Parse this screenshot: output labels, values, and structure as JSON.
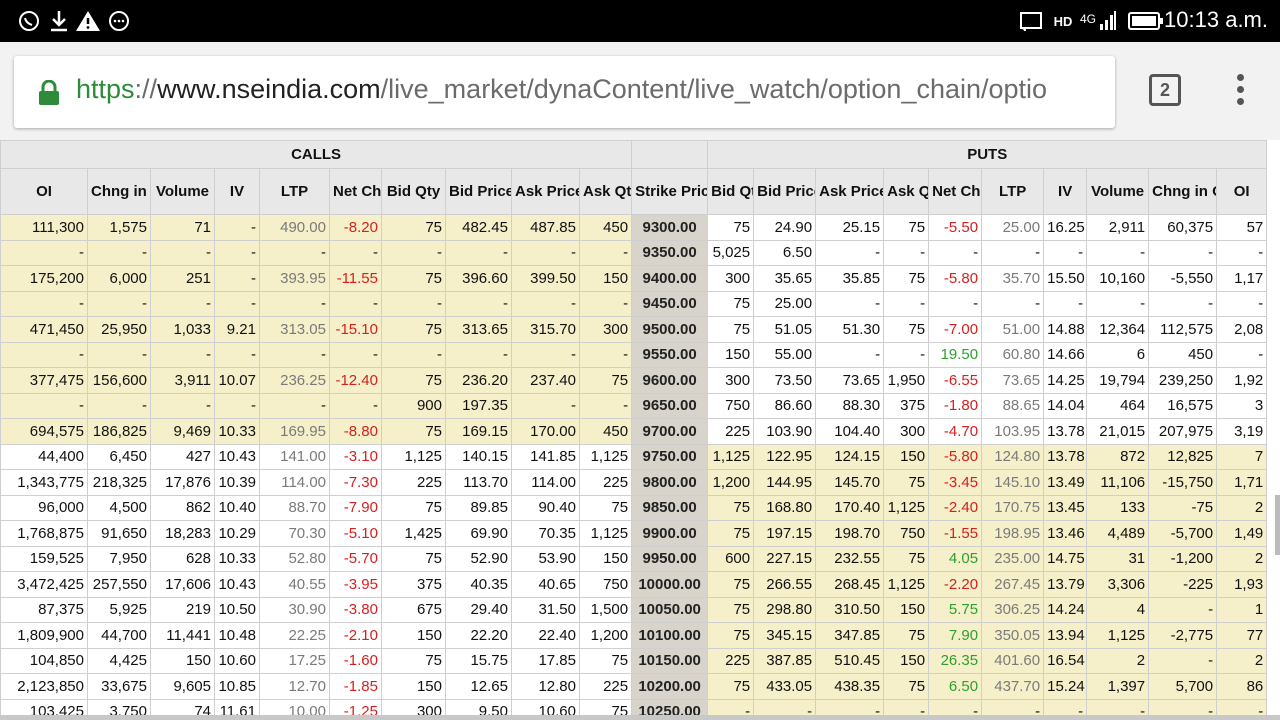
{
  "status_bar": {
    "time": "10:13 a.m.",
    "network": "4G",
    "hd": "HD",
    "icons": [
      "whatsapp-icon",
      "download-icon",
      "warning-icon",
      "more-circle-icon",
      "cast-icon",
      "signal-icon",
      "battery-icon"
    ]
  },
  "browser": {
    "url_protocol": "https",
    "url_sep": "://",
    "url_domain": "www.nseindia.com",
    "url_path": "/live_market/dynaContent/live_watch/option_chain/optio",
    "tab_count": "2"
  },
  "table": {
    "calls_label": "CALLS",
    "puts_label": "PUTS",
    "call_headers": [
      "OI",
      "Chng in OI",
      "Volume",
      "IV",
      "LTP",
      "Net Chng",
      "Bid Qty",
      "Bid Price",
      "Ask Price",
      "Ask Qty"
    ],
    "strike_header": "Strike Price",
    "put_headers": [
      "Bid Qty",
      "Bid Price",
      "Ask Price",
      "Ask Qty",
      "Net Chng",
      "LTP",
      "IV",
      "Volume",
      "Chng in OI",
      "OI"
    ],
    "rows": [
      {
        "calls": [
          "111,300",
          "1,575",
          "71",
          "-",
          "490.00",
          "-8.20",
          "75",
          "482.45",
          "487.85",
          "450"
        ],
        "strike": "9300.00",
        "puts": [
          "75",
          "24.90",
          "25.15",
          "75",
          "-5.50",
          "25.00",
          "16.25",
          "2,911",
          "60,375",
          "57"
        ],
        "call_itm": true,
        "put_itm": false
      },
      {
        "calls": [
          "-",
          "-",
          "-",
          "-",
          "-",
          "-",
          "-",
          "-",
          "-",
          "-"
        ],
        "strike": "9350.00",
        "puts": [
          "5,025",
          "6.50",
          "-",
          "-",
          "-",
          "-",
          "-",
          "-",
          "-",
          "-"
        ],
        "call_itm": true,
        "put_itm": false
      },
      {
        "calls": [
          "175,200",
          "6,000",
          "251",
          "-",
          "393.95",
          "-11.55",
          "75",
          "396.60",
          "399.50",
          "150"
        ],
        "strike": "9400.00",
        "puts": [
          "300",
          "35.65",
          "35.85",
          "75",
          "-5.80",
          "35.70",
          "15.50",
          "10,160",
          "-5,550",
          "1,17"
        ],
        "call_itm": true,
        "put_itm": false
      },
      {
        "calls": [
          "-",
          "-",
          "-",
          "-",
          "-",
          "-",
          "-",
          "-",
          "-",
          "-"
        ],
        "strike": "9450.00",
        "puts": [
          "75",
          "25.00",
          "-",
          "-",
          "-",
          "-",
          "-",
          "-",
          "-",
          "-"
        ],
        "call_itm": true,
        "put_itm": false
      },
      {
        "calls": [
          "471,450",
          "25,950",
          "1,033",
          "9.21",
          "313.05",
          "-15.10",
          "75",
          "313.65",
          "315.70",
          "300"
        ],
        "strike": "9500.00",
        "puts": [
          "75",
          "51.05",
          "51.30",
          "75",
          "-7.00",
          "51.00",
          "14.88",
          "12,364",
          "112,575",
          "2,08"
        ],
        "call_itm": true,
        "put_itm": false
      },
      {
        "calls": [
          "-",
          "-",
          "-",
          "-",
          "-",
          "-",
          "-",
          "-",
          "-",
          "-"
        ],
        "strike": "9550.00",
        "puts": [
          "150",
          "55.00",
          "-",
          "-",
          "19.50",
          "60.80",
          "14.66",
          "6",
          "450",
          "-"
        ],
        "call_itm": true,
        "put_itm": false
      },
      {
        "calls": [
          "377,475",
          "156,600",
          "3,911",
          "10.07",
          "236.25",
          "-12.40",
          "75",
          "236.20",
          "237.40",
          "75"
        ],
        "strike": "9600.00",
        "puts": [
          "300",
          "73.50",
          "73.65",
          "1,950",
          "-6.55",
          "73.65",
          "14.25",
          "19,794",
          "239,250",
          "1,92"
        ],
        "call_itm": true,
        "put_itm": false
      },
      {
        "calls": [
          "-",
          "-",
          "-",
          "-",
          "-",
          "-",
          "900",
          "197.35",
          "-",
          "-"
        ],
        "strike": "9650.00",
        "puts": [
          "750",
          "86.60",
          "88.30",
          "375",
          "-1.80",
          "88.65",
          "14.04",
          "464",
          "16,575",
          "3"
        ],
        "call_itm": true,
        "put_itm": false
      },
      {
        "calls": [
          "694,575",
          "186,825",
          "9,469",
          "10.33",
          "169.95",
          "-8.80",
          "75",
          "169.15",
          "170.00",
          "450"
        ],
        "strike": "9700.00",
        "puts": [
          "225",
          "103.90",
          "104.40",
          "300",
          "-4.70",
          "103.95",
          "13.78",
          "21,015",
          "207,975",
          "3,19"
        ],
        "call_itm": true,
        "put_itm": false
      },
      {
        "calls": [
          "44,400",
          "6,450",
          "427",
          "10.43",
          "141.00",
          "-3.10",
          "1,125",
          "140.15",
          "141.85",
          "1,125"
        ],
        "strike": "9750.00",
        "puts": [
          "1,125",
          "122.95",
          "124.15",
          "150",
          "-5.80",
          "124.80",
          "13.78",
          "872",
          "12,825",
          "7"
        ],
        "call_itm": false,
        "put_itm": true
      },
      {
        "calls": [
          "1,343,775",
          "218,325",
          "17,876",
          "10.39",
          "114.00",
          "-7.30",
          "225",
          "113.70",
          "114.00",
          "225"
        ],
        "strike": "9800.00",
        "puts": [
          "1,200",
          "144.95",
          "145.70",
          "75",
          "-3.45",
          "145.10",
          "13.49",
          "11,106",
          "-15,750",
          "1,71"
        ],
        "call_itm": false,
        "put_itm": true
      },
      {
        "calls": [
          "96,000",
          "4,500",
          "862",
          "10.40",
          "88.70",
          "-7.90",
          "75",
          "89.85",
          "90.40",
          "75"
        ],
        "strike": "9850.00",
        "puts": [
          "75",
          "168.80",
          "170.40",
          "1,125",
          "-2.40",
          "170.75",
          "13.45",
          "133",
          "-75",
          "2"
        ],
        "call_itm": false,
        "put_itm": true
      },
      {
        "calls": [
          "1,768,875",
          "91,650",
          "18,283",
          "10.29",
          "70.30",
          "-5.10",
          "1,425",
          "69.90",
          "70.35",
          "1,125"
        ],
        "strike": "9900.00",
        "puts": [
          "75",
          "197.15",
          "198.70",
          "750",
          "-1.55",
          "198.95",
          "13.46",
          "4,489",
          "-5,700",
          "1,49"
        ],
        "call_itm": false,
        "put_itm": true
      },
      {
        "calls": [
          "159,525",
          "7,950",
          "628",
          "10.33",
          "52.80",
          "-5.70",
          "75",
          "52.90",
          "53.90",
          "150"
        ],
        "strike": "9950.00",
        "puts": [
          "600",
          "227.15",
          "232.55",
          "75",
          "4.05",
          "235.00",
          "14.75",
          "31",
          "-1,200",
          "2"
        ],
        "call_itm": false,
        "put_itm": true
      },
      {
        "calls": [
          "3,472,425",
          "257,550",
          "17,606",
          "10.43",
          "40.55",
          "-3.95",
          "375",
          "40.35",
          "40.65",
          "750"
        ],
        "strike": "10000.00",
        "puts": [
          "75",
          "266.55",
          "268.45",
          "1,125",
          "-2.20",
          "267.45",
          "13.79",
          "3,306",
          "-225",
          "1,93"
        ],
        "call_itm": false,
        "put_itm": true
      },
      {
        "calls": [
          "87,375",
          "5,925",
          "219",
          "10.50",
          "30.90",
          "-3.80",
          "675",
          "29.40",
          "31.50",
          "1,500"
        ],
        "strike": "10050.00",
        "puts": [
          "75",
          "298.80",
          "310.50",
          "150",
          "5.75",
          "306.25",
          "14.24",
          "4",
          "-",
          "1"
        ],
        "call_itm": false,
        "put_itm": true
      },
      {
        "calls": [
          "1,809,900",
          "44,700",
          "11,441",
          "10.48",
          "22.25",
          "-2.10",
          "150",
          "22.20",
          "22.40",
          "1,200"
        ],
        "strike": "10100.00",
        "puts": [
          "75",
          "345.15",
          "347.85",
          "75",
          "7.90",
          "350.05",
          "13.94",
          "1,125",
          "-2,775",
          "77"
        ],
        "call_itm": false,
        "put_itm": true
      },
      {
        "calls": [
          "104,850",
          "4,425",
          "150",
          "10.60",
          "17.25",
          "-1.60",
          "75",
          "15.75",
          "17.85",
          "75"
        ],
        "strike": "10150.00",
        "puts": [
          "225",
          "387.85",
          "510.45",
          "150",
          "26.35",
          "401.60",
          "16.54",
          "2",
          "-",
          "2"
        ],
        "call_itm": false,
        "put_itm": true
      },
      {
        "calls": [
          "2,123,850",
          "33,675",
          "9,605",
          "10.85",
          "12.70",
          "-1.85",
          "150",
          "12.65",
          "12.80",
          "225"
        ],
        "strike": "10200.00",
        "puts": [
          "75",
          "433.05",
          "438.35",
          "75",
          "6.50",
          "437.70",
          "15.24",
          "1,397",
          "5,700",
          "86"
        ],
        "call_itm": false,
        "put_itm": true
      },
      {
        "calls": [
          "103,425",
          "3,750",
          "74",
          "11.61",
          "10.00",
          "-1.25",
          "300",
          "9.50",
          "10.60",
          "75"
        ],
        "strike": "10250.00",
        "puts": [
          "-",
          "-",
          "-",
          "-",
          "-",
          "-",
          "-",
          "-",
          "-",
          "-"
        ],
        "call_itm": false,
        "put_itm": true
      }
    ]
  }
}
